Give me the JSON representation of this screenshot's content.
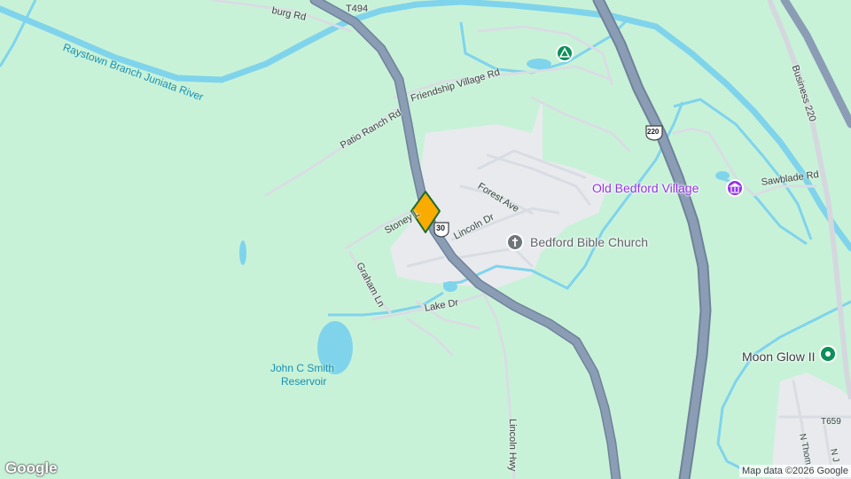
{
  "colors": {
    "land": "#c8f2d8",
    "developed": "#e8eaee",
    "water": "#7fd4ec",
    "highway": "#8a9db5",
    "highway_edge": "#6f829a",
    "road": "#d9dde3",
    "marker_fill": "#f9ab00",
    "marker_stroke": "#1e6b2e",
    "poi_purple": "#9334e6",
    "poi_teal": "#0d8f5a",
    "poi_gray": "#70757a"
  },
  "labels": {
    "raystown_river": "Raystown Branch Juniata River",
    "burg_rd": "burg Rd",
    "t494": "T494",
    "friendship_village_rd": "Friendship Village Rd",
    "patio_ranch_rd": "Patio Ranch Rd",
    "business_220": "Business 220",
    "sawblade_rd": "Sawblade Rd",
    "forest_ave": "Forest Ave",
    "stoney_ln": "Stoney L",
    "lincoln_dr": "Lincoln Dr",
    "graham_ln": "Graham Ln",
    "lake_dr": "Lake Dr",
    "reservoir_line1": "John C Smith",
    "reservoir_line2": "Reservoir",
    "lincoln_hwy": "Lincoln Hwy",
    "t659": "T659",
    "n_thom": "N Thom",
    "n_j": "N J"
  },
  "shields": {
    "us30": "30",
    "us220": "220"
  },
  "pois": {
    "old_bedford_village": {
      "name": "Old Bedford Village",
      "icon": "museum-icon",
      "color": "#9334e6"
    },
    "bedford_bible_church": {
      "name": "Bedford Bible Church",
      "icon": "church-cross-icon",
      "color": "#5f6368"
    },
    "moon_glow": {
      "name": "Moon Glow II",
      "icon": "place-pin-icon",
      "color": "#0d8f5a"
    },
    "campground": {
      "name": "",
      "icon": "campground-icon",
      "color": "#0d8f5a"
    }
  },
  "attribution": {
    "logo": "Google",
    "map_data": "Map data ©2026 Google"
  }
}
